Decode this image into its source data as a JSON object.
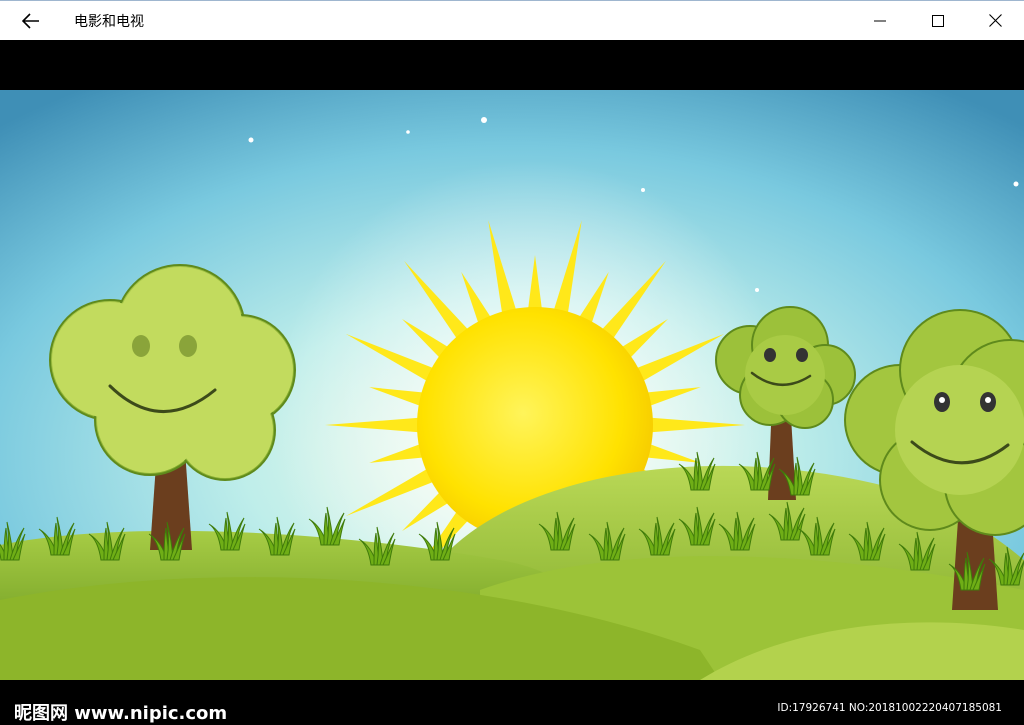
{
  "window": {
    "title": "电影和电视"
  },
  "icons": {
    "back": "back-arrow-icon",
    "minimize": "minimize-icon",
    "maximize": "maximize-icon",
    "close": "close-icon"
  },
  "video": {
    "watermark_site": "昵图网 www.nipic.com",
    "watermark_id": "ID:17926741 NO:20181002220407185081"
  },
  "colors": {
    "titlebar_bg": "#ffffff",
    "sky_top": "#5fb3d9",
    "sky_glow": "#dff6ef",
    "sun": "#ffe400",
    "grass": "#8fbf2a",
    "letterbox": "#000000"
  }
}
